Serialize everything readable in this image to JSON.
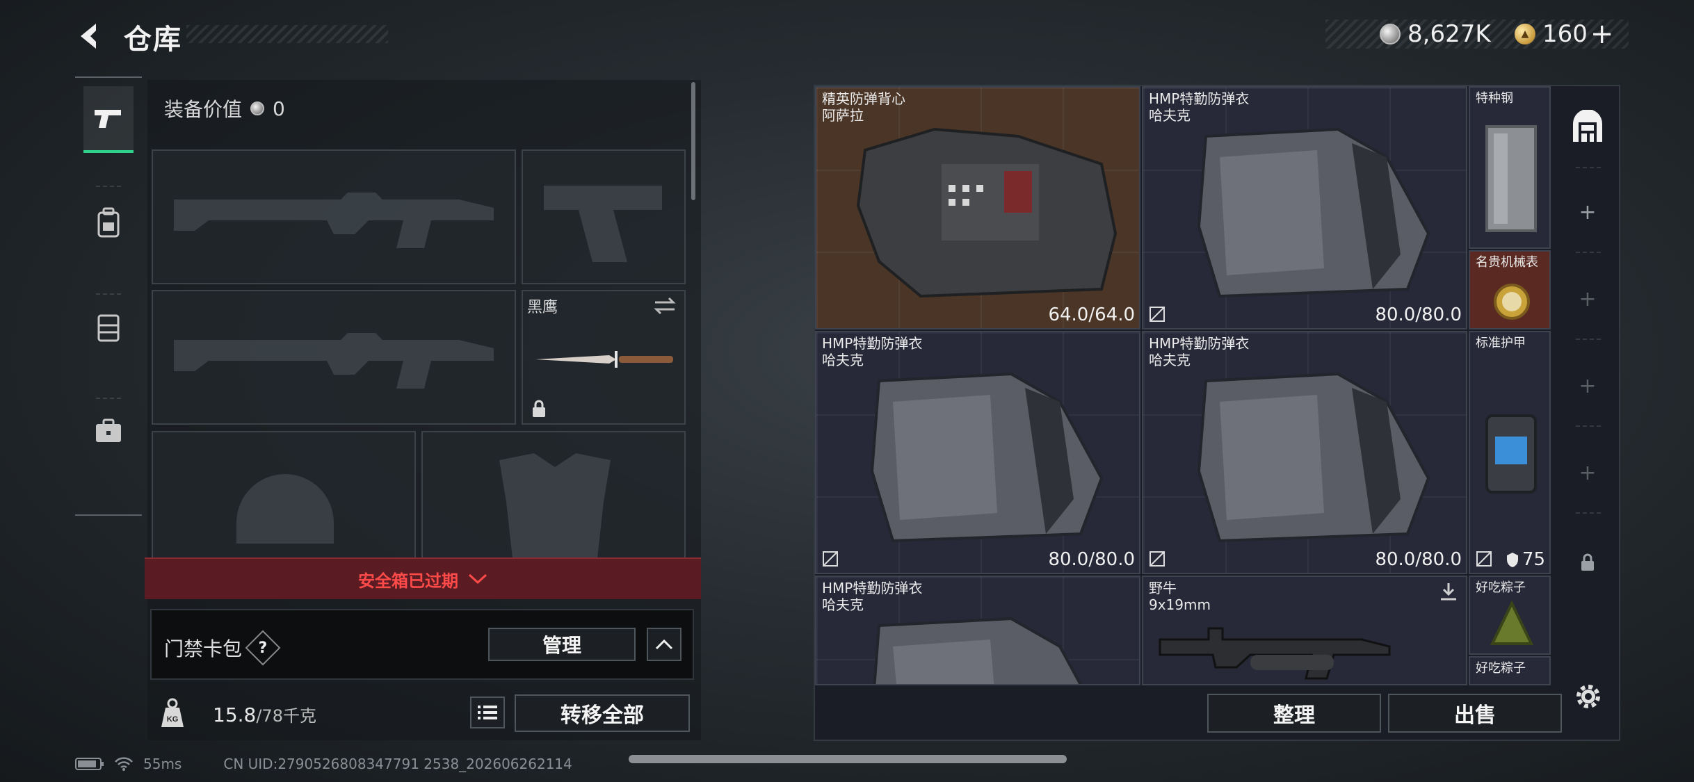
{
  "header": {
    "title": "仓库",
    "currency_main": "8,627K",
    "currency_premium": "160"
  },
  "left_nav": {
    "items": [
      {
        "icon": "pistol-icon",
        "active": true
      },
      {
        "icon": "backpack-icon",
        "active": false
      },
      {
        "icon": "rig-icon",
        "active": false
      },
      {
        "icon": "briefcase-icon",
        "active": false
      }
    ]
  },
  "loadout": {
    "equip_value_label": "装备价值",
    "equip_value": "0",
    "melee_name": "黑鹰",
    "safebox_status": "安全箱已过期",
    "access_pack_label": "门禁卡包",
    "access_help": "?",
    "manage_label": "管理",
    "weight_current": "15.8",
    "weight_max": "/78千克",
    "weight_icon_text": "KG",
    "transfer_all_label": "转移全部"
  },
  "storage": {
    "items": [
      {
        "name": "精英防弹背心",
        "sub": "阿萨拉",
        "durability": "64.0/64.0"
      },
      {
        "name": "HMP特勤防弹衣",
        "sub": "哈夫克",
        "durability": "80.0/80.0"
      },
      {
        "name": "特种钢",
        "sub": ""
      },
      {
        "name": "名贵机械表",
        "sub": ""
      },
      {
        "name": "HMP特勤防弹衣",
        "sub": "哈夫克",
        "durability": "80.0/80.0"
      },
      {
        "name": "HMP特勤防弹衣",
        "sub": "哈夫克",
        "durability": "80.0/80.0"
      },
      {
        "name": "标准护甲",
        "sub": "",
        "armor": "75"
      },
      {
        "name": "HMP特勤防弹衣",
        "sub": "哈夫克"
      },
      {
        "name": "野牛",
        "sub": "9x19mm"
      },
      {
        "name": "好吃粽子",
        "sub": ""
      },
      {
        "name": "好吃粽子",
        "sub": ""
      }
    ],
    "sort_label": "整理",
    "sell_label": "出售"
  },
  "status": {
    "ping": "55ms",
    "uid": "CN UID:2790526808347791 2538_202606262114"
  },
  "colors": {
    "accent_green": "#2fd18a",
    "warning_red": "#ff4a4a",
    "rarity_orange": "#4a3526",
    "rarity_red": "#5a2a22"
  }
}
